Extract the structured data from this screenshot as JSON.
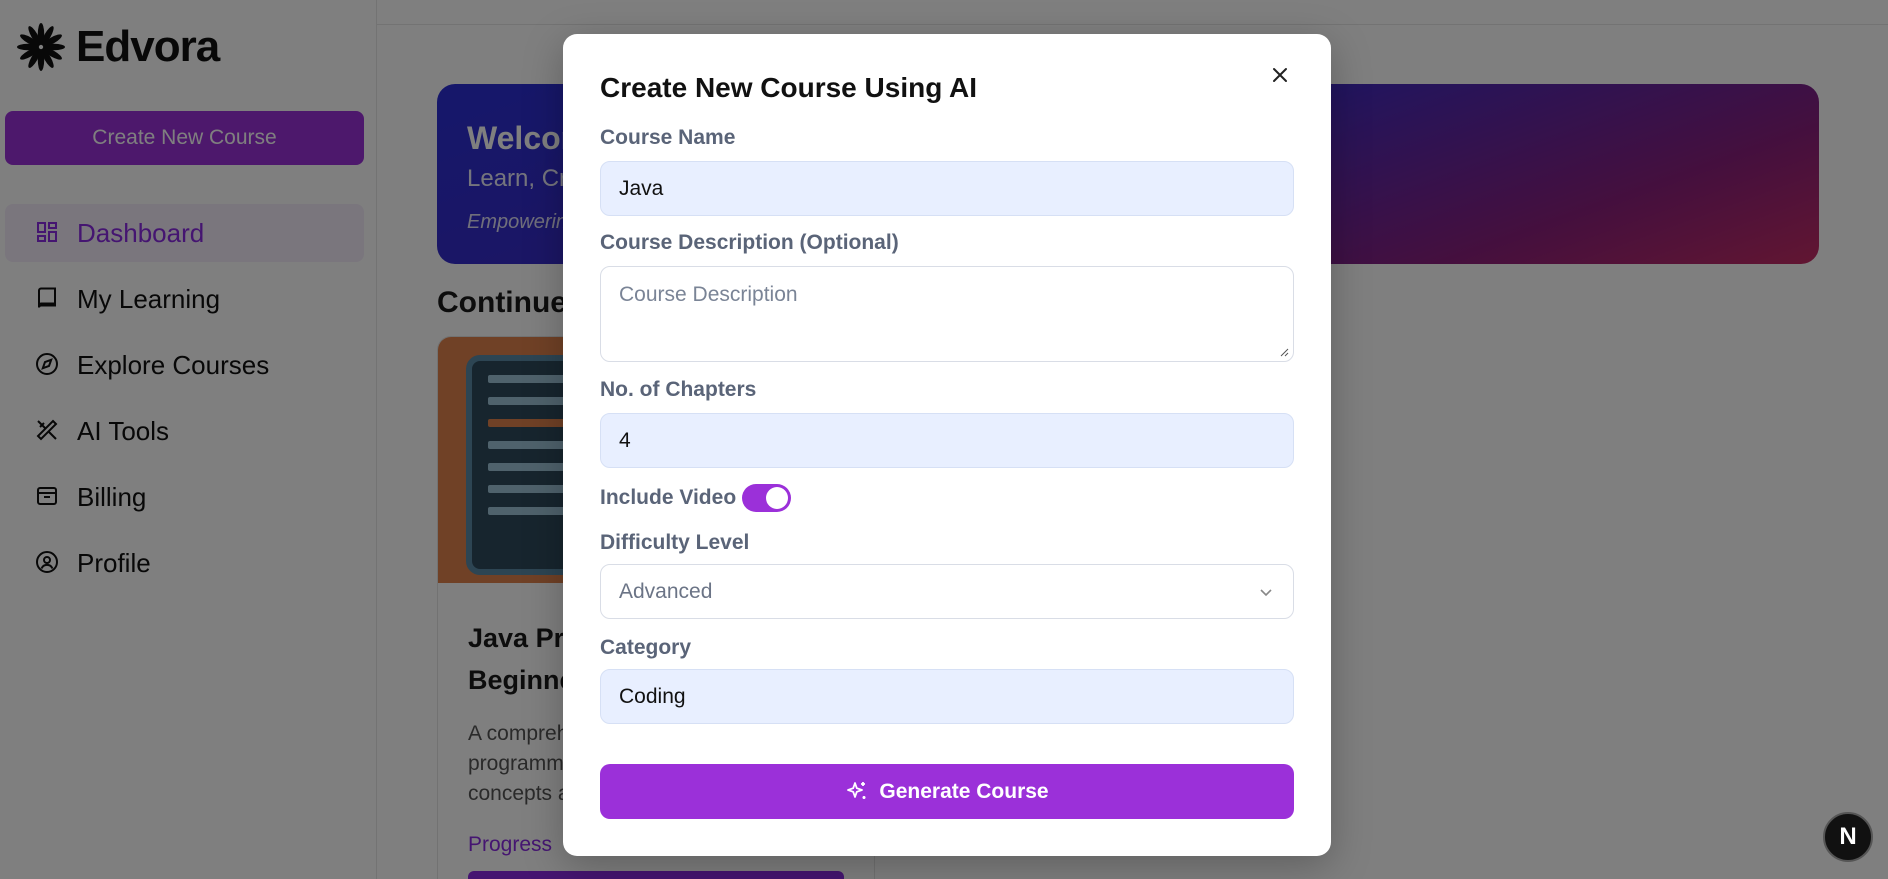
{
  "sidebar": {
    "logo_text": "Edvora",
    "create_button": "Create New Course",
    "items": [
      {
        "label": "Dashboard",
        "icon": "dashboard-icon",
        "active": true
      },
      {
        "label": "My Learning",
        "icon": "book-icon"
      },
      {
        "label": "Explore Courses",
        "icon": "compass-icon"
      },
      {
        "label": "AI Tools",
        "icon": "pen-tool-icon"
      },
      {
        "label": "Billing",
        "icon": "wallet-icon"
      },
      {
        "label": "Profile",
        "icon": "user-circle-icon"
      }
    ]
  },
  "hero": {
    "title": "Welcom",
    "subtitle": "Learn, Cre",
    "tagline": "Empowerin"
  },
  "main": {
    "section_title": "Continue",
    "card": {
      "title_line1": "Java Pro",
      "title_line2": "Beginne",
      "desc_line1": "A compreh",
      "desc_line2": "programm",
      "desc_line3": "concepts a",
      "progress_label": "Progress"
    }
  },
  "modal": {
    "title": "Create New Course Using AI",
    "course_name_label": "Course Name",
    "course_name_value": "Java",
    "description_label": "Course Description (Optional)",
    "description_placeholder": "Course Description",
    "chapters_label": "No. of Chapters",
    "chapters_value": "4",
    "include_video_label": "Include Video",
    "include_video_on": true,
    "difficulty_label": "Difficulty Level",
    "difficulty_value": "Advanced",
    "category_label": "Category",
    "category_value": "Coding",
    "generate_button": "Generate Course"
  },
  "badge": {
    "letter": "N"
  },
  "colors": {
    "accent": "#9b30d9",
    "input_bg": "#e8efff",
    "label": "#5a6478"
  }
}
